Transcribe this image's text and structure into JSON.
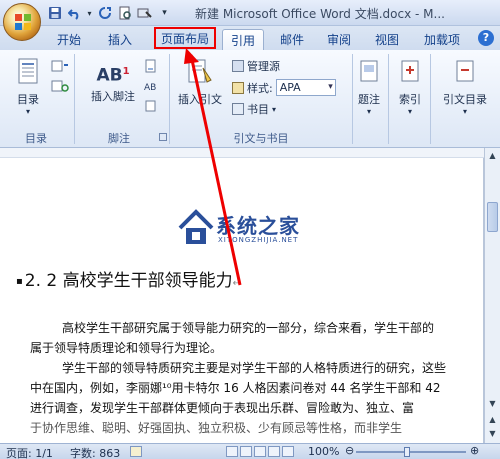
{
  "window": {
    "title": "新建 Microsoft Office Word 文档.docx - M..."
  },
  "tabs": [
    {
      "label": "开始"
    },
    {
      "label": "插入"
    },
    {
      "label": "页面布局"
    },
    {
      "label": "引用"
    },
    {
      "label": "邮件"
    },
    {
      "label": "审阅"
    },
    {
      "label": "视图"
    },
    {
      "label": "加载项"
    }
  ],
  "ribbon": {
    "toc": {
      "label": "目录",
      "group": "目录"
    },
    "footnote": {
      "ab_text": "AB",
      "superscript": "1",
      "label": "插入脚注",
      "group": "脚注"
    },
    "citation": {
      "label": "插入引文",
      "manage": "管理源",
      "style_label": "样式:",
      "style_value": "APA",
      "bibliography": "书目",
      "group": "引文与书目"
    },
    "caption": {
      "label": "题注"
    },
    "index": {
      "label": "索引"
    },
    "toa": {
      "label": "引文目录"
    }
  },
  "document": {
    "heading": "2. 2 高校学生干部领导能力",
    "paragraphs": [
      "高校学生干部研究属于领导能力研究的一部分，综合来看，学生干部的",
      "属于领导特质理论和领导行为理论。",
      "学生干部的领导特质研究主要是对学生干部的人格特质进行的研究，这些",
      "中在国内，例如，李丽娜¹⁰用卡特尔 16 人格因素问卷对 44 名学生干部和 42",
      "进行调查，发现学生干部群体更倾向于表现出乐群、冒险敢为、独立、富",
      "于协作思维、聪明、好强固执、独立积极、少有顾忌等性格，而非学生"
    ]
  },
  "watermark": {
    "title": "系统之家",
    "subtitle": "XITONGZHIJIA.NET"
  },
  "status": {
    "page": "页面: 1/1",
    "words": "字数: 863",
    "zoom": "100%",
    "zoom_level": 100,
    "minus": "⊖",
    "plus": "⊕"
  },
  "colors": {
    "highlight": "#ee0000",
    "accent": "#15428b"
  },
  "icons": {
    "office": "office-logo-icon",
    "save": "save-icon",
    "undo": "undo-icon",
    "redo": "redo-icon"
  }
}
